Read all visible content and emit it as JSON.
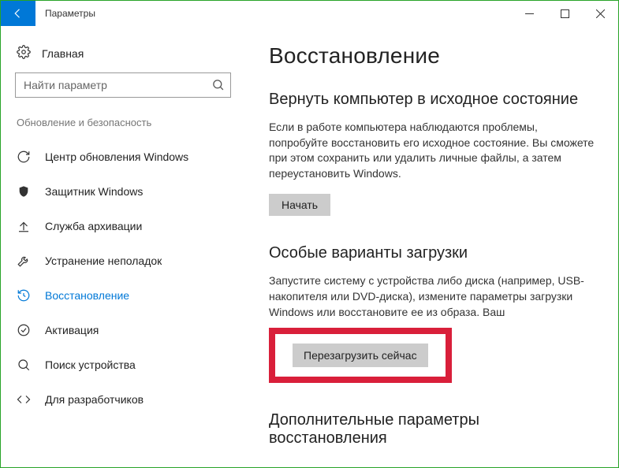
{
  "titlebar": {
    "title": "Параметры"
  },
  "sidebar": {
    "home_label": "Главная",
    "search_placeholder": "Найти параметр",
    "section_label": "Обновление и безопасность",
    "items": [
      {
        "label": "Центр обновления Windows"
      },
      {
        "label": "Защитник Windows"
      },
      {
        "label": "Служба архивации"
      },
      {
        "label": "Устранение неполадок"
      },
      {
        "label": "Восстановление"
      },
      {
        "label": "Активация"
      },
      {
        "label": "Поиск устройства"
      },
      {
        "label": "Для разработчиков"
      }
    ]
  },
  "main": {
    "heading": "Восстановление",
    "reset": {
      "title": "Вернуть компьютер в исходное состояние",
      "body": "Если в работе компьютера наблюдаются проблемы, попробуйте восстановить его исходное состояние. Вы сможете при этом сохранить или удалить личные файлы, а затем переустановить Windows.",
      "button": "Начать"
    },
    "advboot": {
      "title": "Особые варианты загрузки",
      "body": "Запустите систему с устройства либо диска (например, USB-накопителя или DVD-диска), измените параметры загрузки Windows или восстановите ее из образа. Ваш",
      "button": "Перезагрузить сейчас"
    },
    "more": {
      "title": "Дополнительные параметры восстановления"
    }
  }
}
